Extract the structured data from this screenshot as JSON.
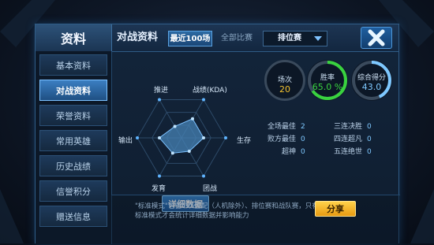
{
  "header": {
    "title": "资料",
    "section_title": "对战资料",
    "filters": [
      "最近100场",
      "全部比赛"
    ],
    "mode_select": "排位赛",
    "close_icon": "close-x-icon"
  },
  "sidebar": {
    "items": [
      {
        "label": "基本资料",
        "active": false
      },
      {
        "label": "对战资料",
        "active": true
      },
      {
        "label": "荣誉资料",
        "active": false
      },
      {
        "label": "常用英雄",
        "active": false
      },
      {
        "label": "历史战绩",
        "active": false
      },
      {
        "label": "信誉积分",
        "active": false
      },
      {
        "label": "赠送信息",
        "active": false
      }
    ]
  },
  "radar": {
    "axes": [
      "推进",
      "战绩(KDA)",
      "生存",
      "团战",
      "发育",
      "输出"
    ],
    "values": [
      0.3,
      0.5,
      0.5,
      0.35,
      0.4,
      0.5
    ]
  },
  "detail_button": "详细数据",
  "stats": {
    "matches": {
      "label": "场次",
      "value": "20",
      "color": "#f2c230"
    },
    "win_rate": {
      "label": "胜率",
      "value": "65.0 %",
      "color": "#39d23f",
      "fraction": 0.65
    },
    "score": {
      "label": "综合得分",
      "value": "43.0",
      "color": "#7ec8ff",
      "fraction": 0.43
    }
  },
  "best": {
    "rows": [
      {
        "label": "全场最佳",
        "value": "2"
      },
      {
        "label": "败方最佳",
        "value": "0"
      },
      {
        "label": "超神",
        "value": "0"
      },
      {
        "label": "三连决胜",
        "value": "0"
      },
      {
        "label": "四连超凡",
        "value": "0"
      },
      {
        "label": "五连绝世",
        "value": "0"
      }
    ]
  },
  "footer": {
    "note": "\"标准模式\"包含5V5匹配（人机除外）、排位赛和战队赛，只有标准模式才会统计详细数据并影响能力",
    "share_button": "分享"
  }
}
